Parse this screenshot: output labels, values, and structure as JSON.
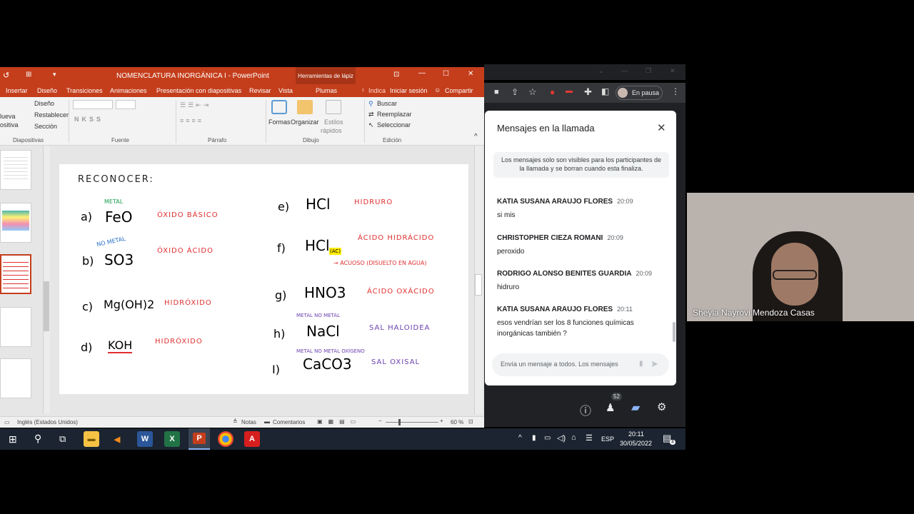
{
  "ppt": {
    "title": "NOMENCLATURA INORGÁNICA I - PowerPoint",
    "context_tab": "Herramientas de lápiz",
    "tabs": [
      "Insertar",
      "Diseño",
      "Transiciones",
      "Animaciones",
      "Presentación con diapositivas",
      "Revisar",
      "Vista"
    ],
    "active_tab": "Plumas",
    "tell_me": "Indica",
    "signin": "Iniciar sesión",
    "share": "Compartir",
    "ribbon": {
      "slides_group": "Diapositivas",
      "new_slide": "lueva",
      "new_slide_2": "ositiva",
      "layout": "Diseño",
      "reset": "Restablecer",
      "section": "Sección",
      "font_group": "Fuente",
      "paragraph_group": "Párrafo",
      "drawing_group": "Dibujo",
      "shapes": "Formas",
      "arrange": "Organizar",
      "styles": "Estilos",
      "styles_2": "rápidos",
      "editing_group": "Edición",
      "find": "Buscar",
      "replace": "Reemplazar",
      "select": "Seleccionar"
    },
    "status": {
      "language": "Inglés (Estados Unidos)",
      "notes": "Notas",
      "comments": "Comentarios",
      "zoom": "60 %"
    },
    "slide": {
      "heading": "RECONOCER:",
      "items": [
        {
          "label": "a)",
          "formula": "FeO",
          "note": "METAL",
          "answer": "ÓXIDO BÁSICO"
        },
        {
          "label": "b)",
          "formula": "SO3",
          "note": "NO METAL",
          "answer": "ÓXIDO ÁCIDO"
        },
        {
          "label": "c)",
          "formula": "Mg(OH)2",
          "note": "",
          "answer": "HIDRÓXIDO"
        },
        {
          "label": "d)",
          "formula": "KOH",
          "note": "",
          "answer": "HIDRÓXIDO"
        },
        {
          "label": "e)",
          "formula": "HCl",
          "note": "",
          "answer": "HIDRURO"
        },
        {
          "label": "f)",
          "formula": "HCl",
          "note": "(AC)",
          "answer": "ÁCIDO HIDRÁCIDO",
          "sub": "→ ACUOSO (DISUELTO EN AGUA)"
        },
        {
          "label": "g)",
          "formula": "HNO3",
          "note": "",
          "answer": "ÁCIDO OXÁCIDO"
        },
        {
          "label": "h)",
          "formula": "NaCl",
          "note": "METAL   NO METAL",
          "answer": "SAL HALOIDEA"
        },
        {
          "label": "I)",
          "formula": "CaCO3",
          "note": "METAL  NO METAL  OXÍGENO",
          "answer": "SAL OXISAL"
        }
      ]
    }
  },
  "taskbar": {
    "time": "20:11",
    "date": "30/05/2022",
    "lang": "ESP",
    "notif_count": "4"
  },
  "chrome": {
    "profile": "En pausa"
  },
  "meet": {
    "panel_title": "Mensajes en la llamada",
    "notice": "Los mensajes solo son visibles para los participantes de la llamada y se borran cuando esta finaliza.",
    "messages": [
      {
        "name": "KATIA SUSANA ARAUJO FLORES",
        "time": "20:09",
        "text": "si mis"
      },
      {
        "name": "CHRISTOPHER CIEZA ROMANI",
        "time": "20:09",
        "text": "peroxido"
      },
      {
        "name": "RODRIGO ALONSO BENITES GUARDIA",
        "time": "20:09",
        "text": "hidruro"
      },
      {
        "name": "KATIA SUSANA ARAUJO FLORES",
        "time": "20:11",
        "text": "esos vendrían ser los 8 funciones químicas inorgánicas también ?"
      }
    ],
    "input_placeholder": "Envía un mensaje a todos. Los mensajes",
    "participants_badge": "52",
    "participant_name": "Sheyla Nayrovi Mendoza Casas"
  },
  "colors": {
    "ppt_red": "#c43e1c",
    "meet_blue": "#8ab4f8",
    "hand_red": "#e03030",
    "hand_green": "#1a9a50",
    "hand_blue": "#2a6fc9",
    "hand_purple": "#6a3fb0"
  }
}
